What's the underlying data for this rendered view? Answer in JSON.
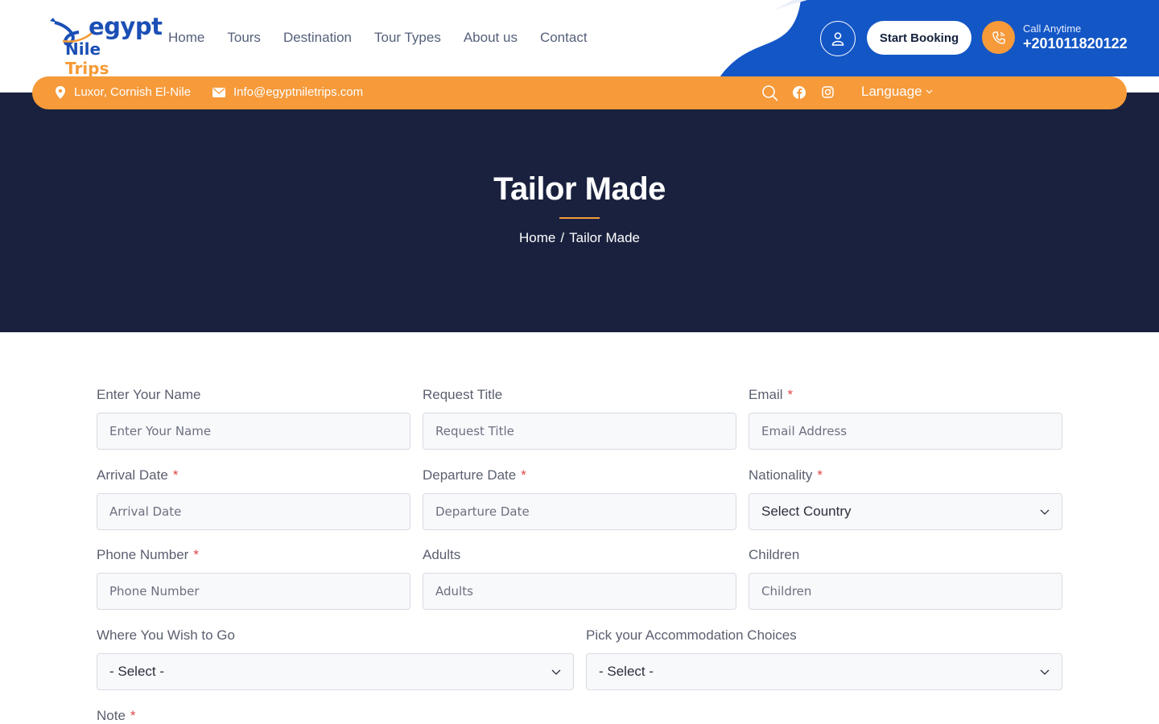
{
  "logo": {
    "line1": "egypt",
    "line2a": "Nile ",
    "line2b": "Trips"
  },
  "nav": {
    "items": [
      "Home",
      "Tours",
      "Destination",
      "Tour Types",
      "About us",
      "Contact"
    ]
  },
  "header": {
    "booking_label": "Start Booking",
    "call_label": "Call Anytime",
    "call_number": "+201011820122"
  },
  "topbar": {
    "location": "Luxor, Cornish El-Nile",
    "email": "Info@egyptniletrips.com",
    "language": "Language"
  },
  "hero": {
    "title": "Tailor Made",
    "breadcrumb_home": "Home",
    "breadcrumb_sep": "/",
    "breadcrumb_current": "Tailor Made"
  },
  "form": {
    "name": {
      "label": "Enter Your Name",
      "placeholder": "Enter Your Name"
    },
    "request_title": {
      "label": "Request Title",
      "placeholder": "Request Title"
    },
    "email": {
      "label": "Email",
      "placeholder": "Email Address",
      "required": "*"
    },
    "arrival": {
      "label": "Arrival Date",
      "placeholder": "Arrival Date",
      "required": "*"
    },
    "departure": {
      "label": "Departure Date",
      "placeholder": "Departure Date",
      "required": "*"
    },
    "nationality": {
      "label": "Nationality",
      "value": "Select Country",
      "required": "*"
    },
    "phone": {
      "label": "Phone Number",
      "placeholder": "Phone Number",
      "required": "*"
    },
    "adults": {
      "label": "Adults",
      "placeholder": "Adults"
    },
    "children": {
      "label": "Children",
      "placeholder": "Children"
    },
    "destination": {
      "label": "Where You Wish to Go",
      "value": "- Select -"
    },
    "accommodation": {
      "label": "Pick your Accommodation Choices",
      "value": "- Select -"
    },
    "note": {
      "label": "Note",
      "required": "*"
    }
  },
  "colors": {
    "brand_blue": "#1b4fb5",
    "accent_orange": "#f69a3a",
    "hero_bg": "#19213e"
  }
}
